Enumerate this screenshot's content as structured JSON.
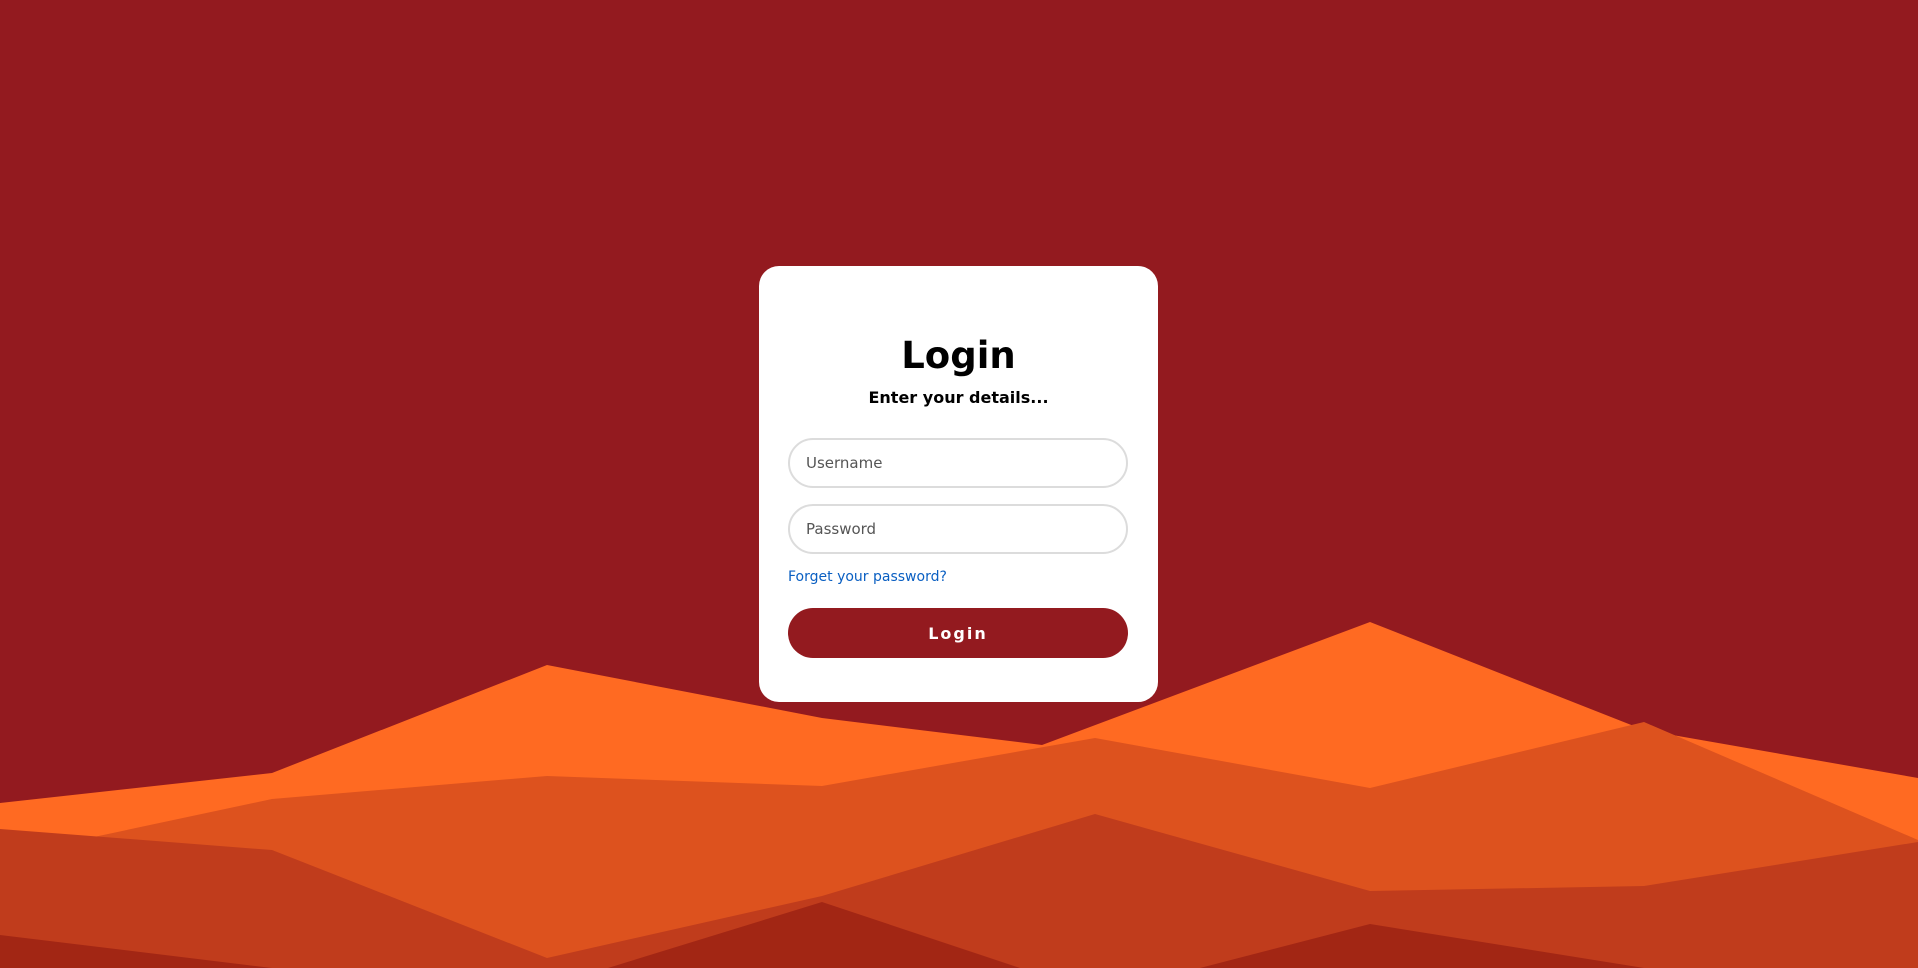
{
  "colors": {
    "background": "#931a1f",
    "card": "#ffffff",
    "accent": "#931a1f",
    "link": "#0a5fc2",
    "mountain_light": "#ff6a22",
    "mountain_mid": "#dd521e",
    "mountain_dark": "#c03c1c",
    "mountain_darkest": "#a22614"
  },
  "login": {
    "title": "Login",
    "subtitle": "Enter your details...",
    "username_placeholder": "Username",
    "username_value": "",
    "password_placeholder": "Password",
    "password_value": "",
    "forgot_label": "Forget your password?",
    "submit_label": "Login"
  }
}
